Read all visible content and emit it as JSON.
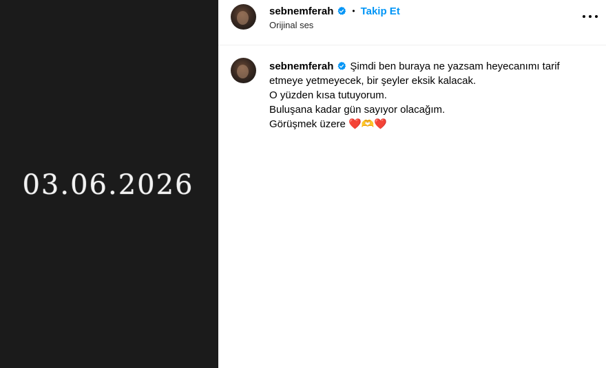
{
  "media": {
    "overlay_text": "03.06.2026"
  },
  "header": {
    "username": "sebnemferah",
    "separator": "•",
    "follow_label": "Takip Et",
    "subtitle": "Orijinal ses"
  },
  "comment": {
    "username": "sebnemferah",
    "line1": "Şimdi ben buraya ne yazsam heyecanımı tarif",
    "line2": "etmeye yetmeyecek, bir şeyler eksik kalacak.",
    "line3": "O yüzden kısa tutuyorum.",
    "line4": "Buluşana kadar gün sayıyor olacağım.",
    "line5": "Görüşmek üzere ❤️🫶❤️"
  },
  "colors": {
    "accent": "#0095f6",
    "media_bg": "#1b1b1b",
    "verified": "#0095f6"
  },
  "icons": {
    "verified": "verified-badge-icon",
    "more": "more-options-icon"
  }
}
